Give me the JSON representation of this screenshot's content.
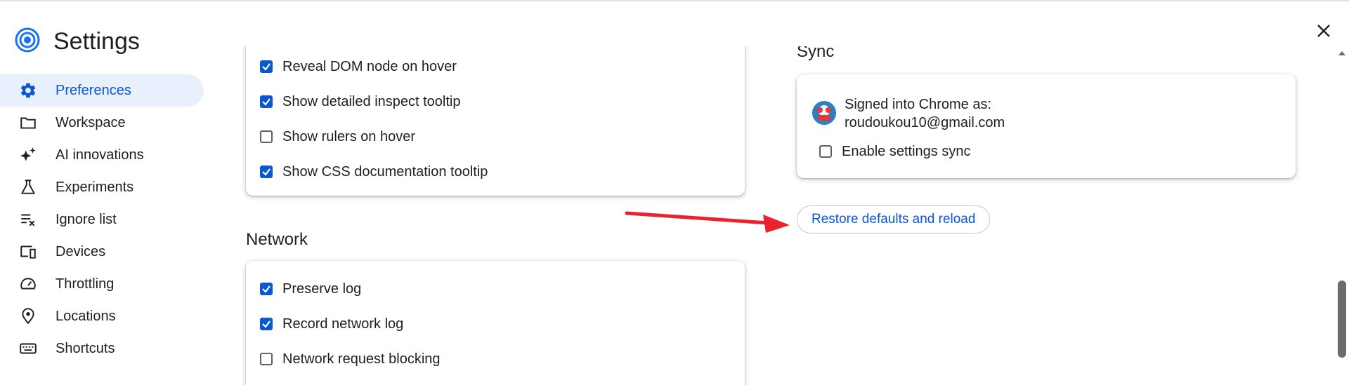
{
  "app": {
    "title": "Settings",
    "close_label": "Close"
  },
  "sidebar": {
    "items": [
      {
        "label": "Preferences",
        "icon": "gear-icon",
        "active": true
      },
      {
        "label": "Workspace",
        "icon": "folder-icon"
      },
      {
        "label": "AI innovations",
        "icon": "sparkle-icon"
      },
      {
        "label": "Experiments",
        "icon": "flask-icon"
      },
      {
        "label": "Ignore list",
        "icon": "ignore-list-icon"
      },
      {
        "label": "Devices",
        "icon": "devices-icon"
      },
      {
        "label": "Throttling",
        "icon": "speedometer-icon"
      },
      {
        "label": "Locations",
        "icon": "location-pin-icon"
      },
      {
        "label": "Shortcuts",
        "icon": "keyboard-icon"
      }
    ]
  },
  "elements_card": {
    "options": [
      {
        "label": "Reveal DOM node on hover",
        "checked": true
      },
      {
        "label": "Show detailed inspect tooltip",
        "checked": true
      },
      {
        "label": "Show rulers on hover",
        "checked": false
      },
      {
        "label": "Show CSS documentation tooltip",
        "checked": true
      }
    ]
  },
  "network": {
    "title": "Network",
    "options": [
      {
        "label": "Preserve log",
        "checked": true
      },
      {
        "label": "Record network log",
        "checked": true
      },
      {
        "label": "Network request blocking",
        "checked": false
      }
    ]
  },
  "sync": {
    "title": "Sync",
    "signed_in_label": "Signed into Chrome as:",
    "email": "roudoukou10@gmail.com",
    "enable_label": "Enable settings sync",
    "enable_checked": false
  },
  "restore_button": {
    "label": "Restore defaults and reload"
  },
  "colors": {
    "accent": "#0b57d0",
    "arrow": "#e8232c",
    "active_bg": "#e8f0fe"
  }
}
